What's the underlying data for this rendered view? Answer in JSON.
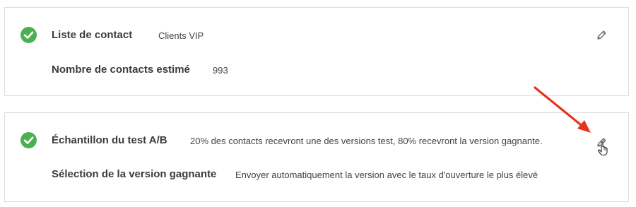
{
  "colors": {
    "success": "#4cb050",
    "annotation_arrow": "#e8321e",
    "border": "#dcdcdc",
    "label_text": "#3c3c3c",
    "value_text": "#444444"
  },
  "contact_section": {
    "status_icon": "check-circle-icon",
    "list_label": "Liste de contact",
    "list_value": "Clients VIP",
    "estimate_label": "Nombre de contacts estimé",
    "estimate_value": "993",
    "edit_icon": "pencil-icon"
  },
  "ab_section": {
    "status_icon": "check-circle-icon",
    "sample_label": "Échantillon du test A/B",
    "sample_value": "20% des contacts recevront une des versions test, 80% recevront la version gagnante.",
    "winner_label": "Sélection de la version gagnante",
    "winner_value": "Envoyer automatiquement la version avec le taux d'ouverture le plus élevé",
    "edit_icon": "pencil-icon",
    "cursor_icon": "hand-pointer-icon"
  },
  "annotation": {
    "icon": "red-arrow-icon"
  }
}
